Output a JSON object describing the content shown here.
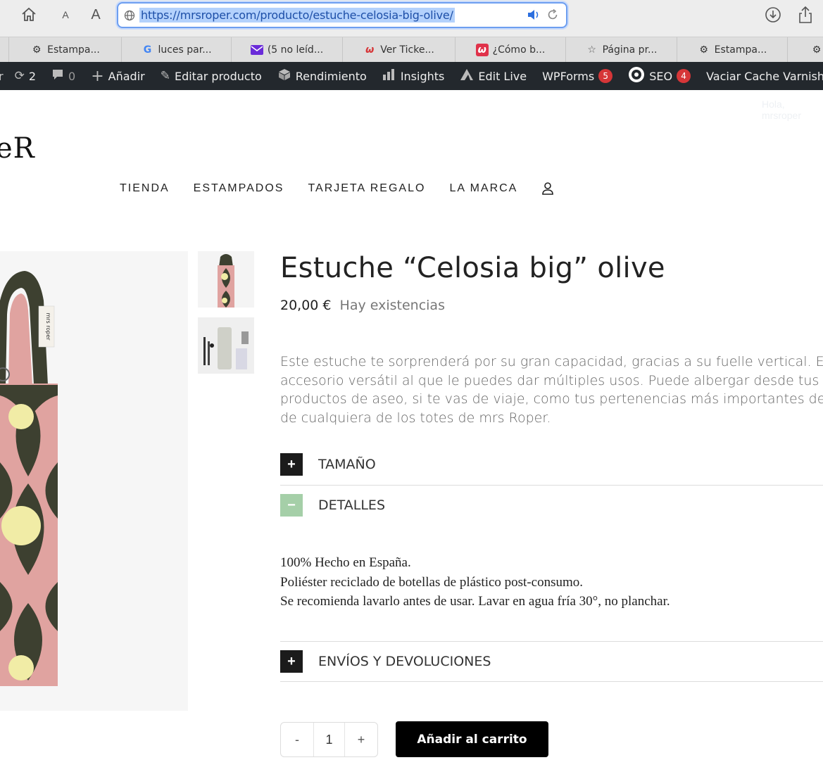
{
  "browser": {
    "url": "https://mrsroper.com/producto/estuche-celosia-big-olive/",
    "text_size_small": "A",
    "text_size_large": "A"
  },
  "tabs": [
    {
      "label": "Estampa...",
      "icon": "gear-icon"
    },
    {
      "label": "luces par...",
      "icon": "google-icon"
    },
    {
      "label": "(5 no leíd...",
      "icon": "mail-icon"
    },
    {
      "label": "Ver Ticke...",
      "icon": "w-icon"
    },
    {
      "label": "¿Cómo b...",
      "icon": "w-icon"
    },
    {
      "label": "Página pr...",
      "icon": "star-icon"
    },
    {
      "label": "Estampa...",
      "icon": "gear-icon"
    }
  ],
  "adminbar": {
    "updates_count": "2",
    "comments_count": "0",
    "add_label": "Añadir",
    "edit_product_label": "Editar producto",
    "performance_label": "Rendimiento",
    "insights_label": "Insights",
    "edit_live_label": "Edit Live",
    "wpforms_label": "WPForms",
    "wpforms_badge": "5",
    "seo_label": "SEO",
    "seo_badge": "4",
    "cache_label": "Vaciar Cache Varnish",
    "greeting": "Hola, mrsroper"
  },
  "site": {
    "logo_fragment": "eR"
  },
  "nav": {
    "items": [
      "TIENDA",
      "ESTAMPADOS",
      "TARJETA REGALO",
      "LA MARCA"
    ]
  },
  "product": {
    "title": "Estuche “Celosia big” olive",
    "price": "20,00 €",
    "stock": "Hay existencias",
    "description_lines": [
      "Este estuche te sorprenderá por su gran capacidad, gracias a su fuelle vertical. Es",
      "accesorio versátil al que le puedes dar múltiples usos. Puede albergar desde tus",
      "productos de aseo, si te vas de viaje, como tus pertenencias más importantes de",
      "de cualquiera de los totes de mrs Roper."
    ],
    "label_text": "mrs roper"
  },
  "accordion": {
    "size_label": "TAMAÑO",
    "details_label": "DETALLES",
    "shipping_label": "ENVÍOS Y DEVOLUCIONES",
    "plus_symbol": "+",
    "minus_symbol": "−"
  },
  "details": {
    "lines": [
      "100% Hecho en España.",
      "Poliéster reciclado de botellas de plástico post-consumo.",
      "Se recomienda lavarlo antes de usar. Lavar en agua fría 30°, no planchar."
    ]
  },
  "cart": {
    "minus": "-",
    "quantity": "1",
    "plus": "+",
    "add_to_cart_label": "Añadir al carrito"
  },
  "colors": {
    "accordion_open": "#a5cfa8",
    "adminbar_bg": "#23282d",
    "badge": "#d63638",
    "product_pink": "#e0a3a0",
    "product_olive": "#3d4030",
    "product_yellow": "#f1eca6"
  }
}
